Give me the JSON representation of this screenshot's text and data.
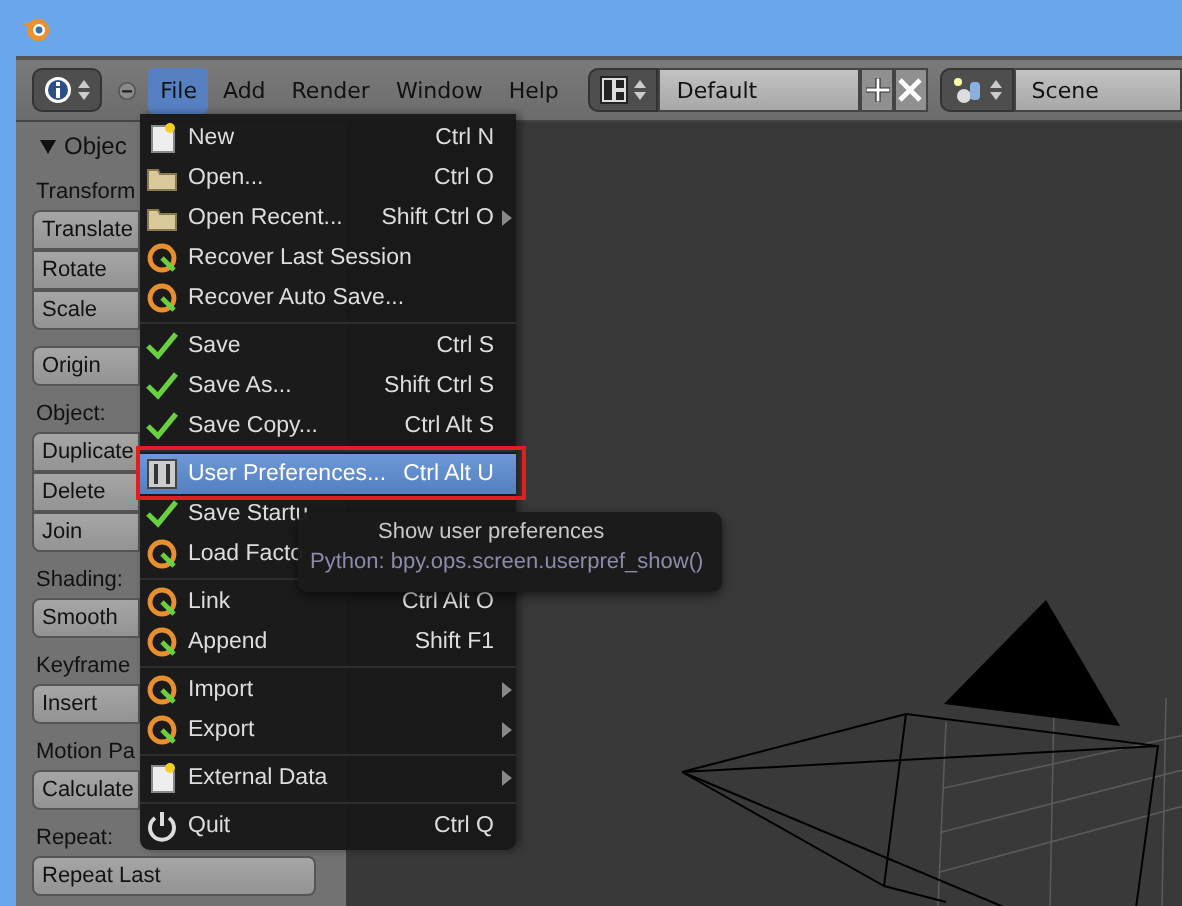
{
  "header": {
    "menus": [
      {
        "label": "File",
        "selected": true
      },
      {
        "label": "Add",
        "selected": false
      },
      {
        "label": "Render",
        "selected": false
      },
      {
        "label": "Window",
        "selected": false
      },
      {
        "label": "Help",
        "selected": false
      }
    ],
    "screen_layout": {
      "value": "Default"
    },
    "scene": {
      "value": "Scene"
    }
  },
  "toolshelf": {
    "panel_title": "Objec",
    "sections": [
      {
        "label": "Transform",
        "groups": [
          [
            "Translate",
            "Rotate",
            "Scale"
          ],
          [
            "Origin"
          ]
        ]
      },
      {
        "label": "Object:",
        "groups": [
          [
            "Duplicate",
            "Delete",
            "Join"
          ]
        ]
      },
      {
        "label": "Shading:",
        "groups": [
          [
            "Smooth"
          ]
        ]
      },
      {
        "label": "Keyframe",
        "groups": [
          [
            "Insert"
          ]
        ]
      },
      {
        "label": "Motion Pa",
        "groups": [
          [
            "Calculate"
          ]
        ]
      },
      {
        "label": "Repeat:",
        "groups": [
          [
            "Repeat Last"
          ]
        ]
      }
    ]
  },
  "file_menu": {
    "groups": [
      [
        {
          "label": "New",
          "shortcut": "Ctrl N",
          "submenu": false,
          "selected": false
        },
        {
          "label": "Open...",
          "shortcut": "Ctrl O",
          "submenu": false,
          "selected": false
        },
        {
          "label": "Open Recent...",
          "shortcut": "Shift Ctrl O",
          "submenu": true,
          "selected": false
        },
        {
          "label": "Recover Last Session",
          "submenu": false,
          "selected": false
        },
        {
          "label": "Recover Auto Save...",
          "submenu": false,
          "selected": false
        }
      ],
      [
        {
          "label": "Save",
          "shortcut": "Ctrl S",
          "submenu": false,
          "selected": false
        },
        {
          "label": "Save As...",
          "shortcut": "Shift Ctrl S",
          "submenu": false,
          "selected": false
        },
        {
          "label": "Save Copy...",
          "shortcut": "Ctrl Alt S",
          "submenu": false,
          "selected": false
        }
      ],
      [
        {
          "label": "User Preferences...",
          "shortcut": "Ctrl Alt U",
          "submenu": false,
          "selected": true
        },
        {
          "label": "Save Startu",
          "submenu": false,
          "selected": false
        },
        {
          "label": "Load Facto",
          "submenu": false,
          "selected": false
        }
      ],
      [
        {
          "label": "Link",
          "shortcut": "Ctrl Alt O",
          "submenu": false,
          "selected": false
        },
        {
          "label": "Append",
          "shortcut": "Shift F1",
          "submenu": false,
          "selected": false
        }
      ],
      [
        {
          "label": "Import",
          "submenu": true,
          "selected": false
        },
        {
          "label": "Export",
          "submenu": true,
          "selected": false
        }
      ],
      [
        {
          "label": "External Data",
          "submenu": true,
          "selected": false
        }
      ],
      [
        {
          "label": "Quit",
          "shortcut": "Ctrl Q",
          "submenu": false,
          "selected": false
        }
      ]
    ]
  },
  "tooltip": {
    "title": "Show user preferences",
    "python": "Python: bpy.ops.screen.userpref_show()"
  }
}
